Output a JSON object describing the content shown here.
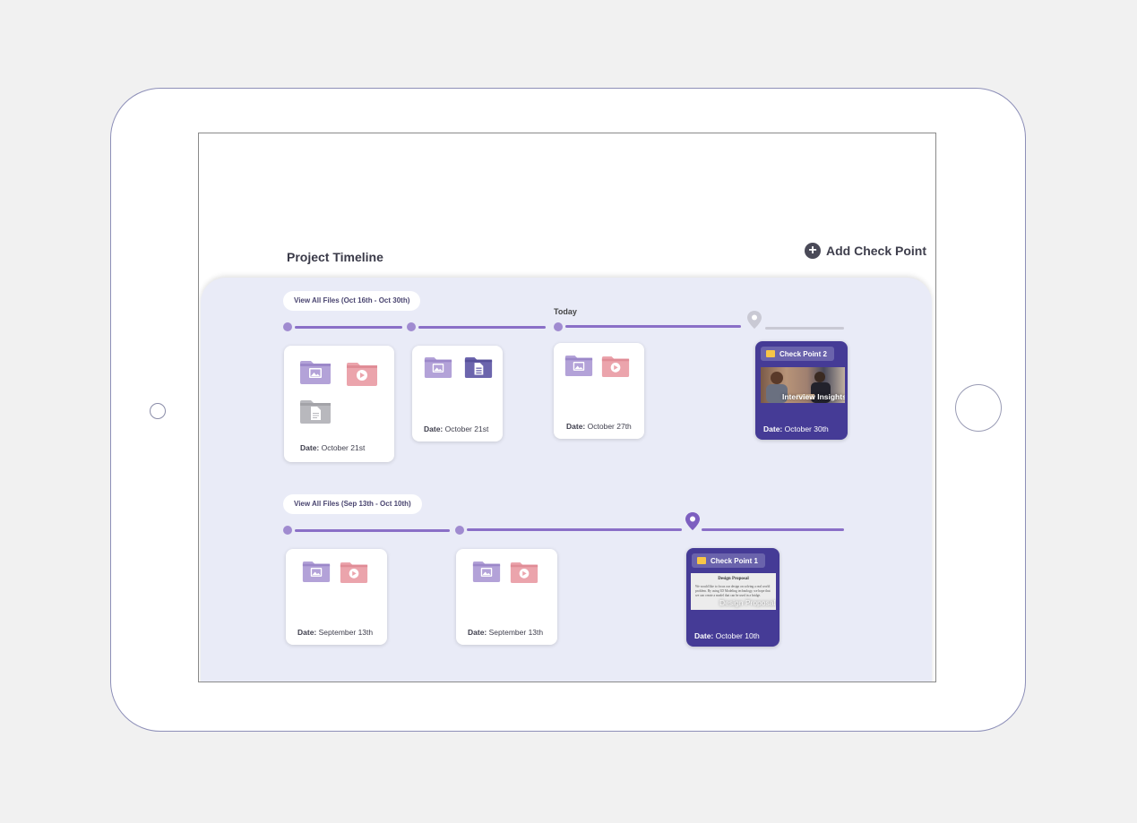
{
  "page": {
    "title": "Project Timeline",
    "add_checkpoint_label": "Add Check Point",
    "today_label": "Today"
  },
  "colors": {
    "timeline": "#8a6fc7",
    "checkpoint_card": "#453b96",
    "panel": "#e9ebf7",
    "folder_purple": "#b3a2d8",
    "folder_pink": "#eba4ac",
    "folder_grey": "#b8b8bd",
    "folder_indigo": "#6c65ad"
  },
  "timelines": [
    {
      "view_all_label": "View All Files (Oct 16th - Oct 30th)",
      "cards": [
        {
          "date_prefix": "Date:",
          "date": "October 21st",
          "icons": [
            "image-folder-icon",
            "video-folder-icon",
            "document-folder-icon"
          ]
        },
        {
          "date_prefix": "Date:",
          "date": "October 21st",
          "icons": [
            "image-folder-icon",
            "document-folder-icon"
          ]
        },
        {
          "date_prefix": "Date:",
          "date": "October 27th",
          "icons": [
            "image-folder-icon",
            "video-folder-icon"
          ]
        }
      ],
      "checkpoint": {
        "label": "Check Point 2",
        "thumb_caption": "Interview Insights",
        "date_prefix": "Date:",
        "date": "October 30th",
        "pin_icon": "location-pin-icon"
      }
    },
    {
      "view_all_label": "View All Files (Sep 13th - Oct 10th)",
      "cards": [
        {
          "date_prefix": "Date:",
          "date": "September 13th",
          "icons": [
            "image-folder-icon",
            "video-folder-icon"
          ]
        },
        {
          "date_prefix": "Date:",
          "date": "September 13th",
          "icons": [
            "image-folder-icon",
            "video-folder-icon"
          ]
        }
      ],
      "checkpoint": {
        "label": "Check Point 1",
        "doc_title": "Design Proposal",
        "doc_body": "We would like to focus our design on solving a real world problem. By using 3D Modeling technology, we hope that we can create a model that can be used in a bridge.",
        "thumb_caption": "Design Proposal",
        "date_prefix": "Date:",
        "date": "October 10th",
        "pin_icon": "location-pin-icon"
      }
    }
  ]
}
